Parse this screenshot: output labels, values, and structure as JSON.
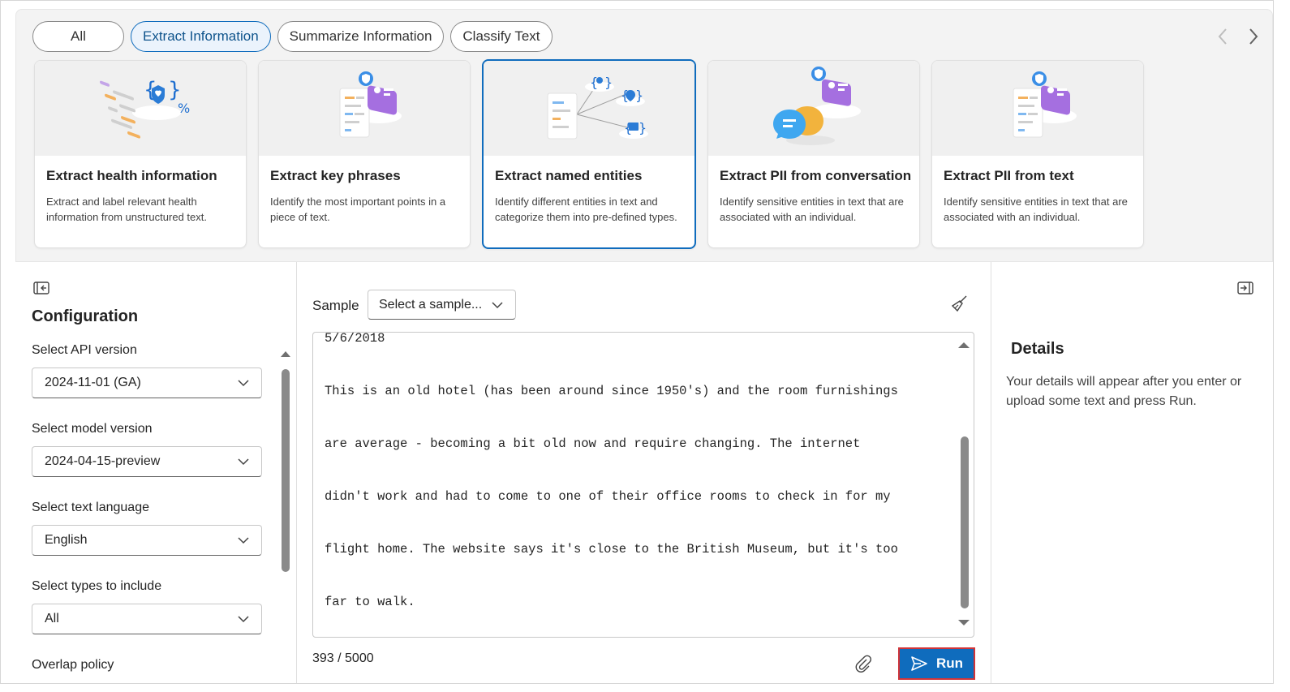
{
  "filters": {
    "items": [
      {
        "label": "All"
      },
      {
        "label": "Extract Information"
      },
      {
        "label": "Summarize Information"
      },
      {
        "label": "Classify Text"
      }
    ]
  },
  "cards": [
    {
      "title": "Extract health information",
      "description": "Extract and label relevant health information from unstructured text.",
      "icon": "health-extraction-icon"
    },
    {
      "title": "Extract key phrases",
      "description": "Identify the most important points in a piece of text.",
      "icon": "key-phrases-icon"
    },
    {
      "title": "Extract named entities",
      "description": "Identify different entities in text and categorize them into pre-defined types.",
      "icon": "named-entities-icon"
    },
    {
      "title": "Extract PII from conversation",
      "description": "Identify sensitive entities in text that are associated with an individual.",
      "icon": "pii-conversation-icon"
    },
    {
      "title": "Extract PII from text",
      "description": "Identify sensitive entities in text that are associated with an individual.",
      "icon": "pii-text-icon"
    }
  ],
  "config": {
    "title": "Configuration",
    "api_version": {
      "label": "Select API version",
      "value": "2024-11-01 (GA)"
    },
    "model_version": {
      "label": "Select model version",
      "value": "2024-04-15-preview"
    },
    "text_language": {
      "label": "Select text language",
      "value": "English"
    },
    "types": {
      "label": "Select types to include",
      "value": "All"
    },
    "overlap": {
      "label": "Overlap policy"
    }
  },
  "editor": {
    "sample_label": "Sample",
    "sample_placeholder": "Select a sample...",
    "lines": [
      "5/6/2018",
      "This is an old hotel (has been around since 1950's) and the room furnishings",
      "are average - becoming a bit old now and require changing. The internet",
      "didn't work and had to come to one of their office rooms to check in for my",
      "flight home. The website says it's close to the British Museum, but it's too",
      "far to walk."
    ],
    "char_count": "393 / 5000",
    "run_label": "Run"
  },
  "details": {
    "title": "Details",
    "message": "Your details will appear after you enter or upload some text and press Run."
  },
  "colors": {
    "accent": "#0f6cbd",
    "highlight_border": "#d13438"
  }
}
